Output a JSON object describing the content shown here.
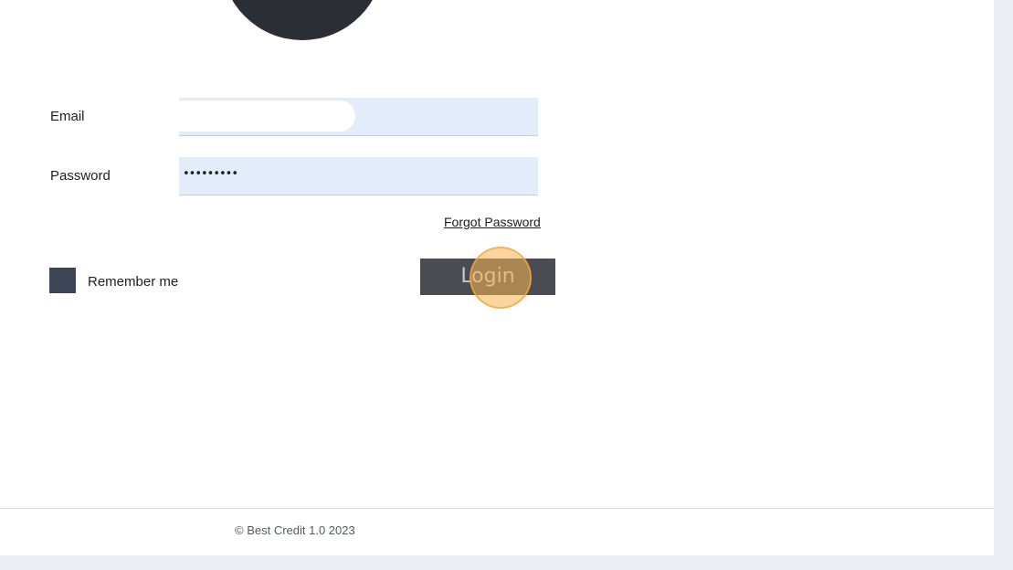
{
  "login_form": {
    "email_label": "Email",
    "email_value": "",
    "password_label": "Password",
    "password_value": "•••••••••",
    "forgot_password_label": "Forgot Password",
    "remember_me_label": "Remember me",
    "remember_me_checked": true,
    "login_button_label": "Login"
  },
  "footer": {
    "copyright": "© Best Credit 1.0 2023"
  },
  "colors": {
    "background": "#eceef6",
    "logo": "#2b2e35",
    "input_fill": "#e3ecfb",
    "checkbox": "#3c4658",
    "button": "#4a4c52",
    "click_highlight": "#f5b450"
  }
}
